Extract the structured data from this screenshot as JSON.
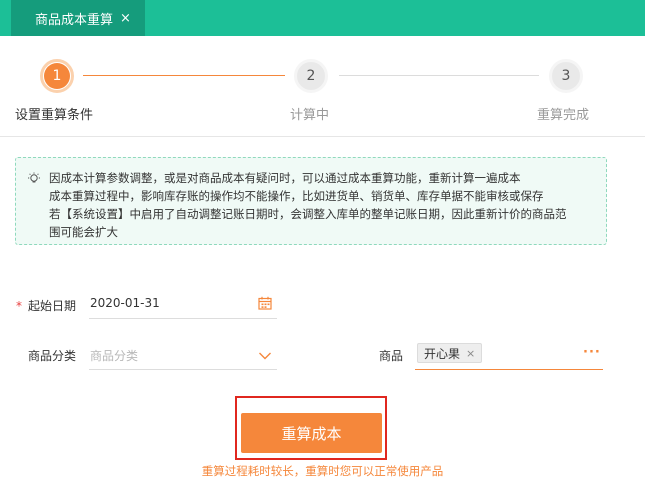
{
  "tab": {
    "label": "商品成本重算",
    "close": "×"
  },
  "steps": [
    {
      "number": "1",
      "label": "设置重算条件"
    },
    {
      "number": "2",
      "label": "计算中"
    },
    {
      "number": "3",
      "label": "重算完成"
    }
  ],
  "notice": {
    "lines": [
      "因成本计算参数调整，或是对商品成本有疑问时，可以通过成本重算功能，重新计算一遍成本",
      "成本重算过程中，影响库存账的操作均不能操作，比如进货单、销货单、库存单据不能审核或保存",
      "若【系统设置】中启用了自动调整记账日期时，会调整入库单的整单记账日期，因此重新计价的商品范",
      "围可能会扩大"
    ]
  },
  "form": {
    "start_date": {
      "required_mark": "*",
      "label": "起始日期",
      "value": "2020-01-31"
    },
    "category": {
      "label": "商品分类",
      "placeholder": "商品分类"
    },
    "product": {
      "label": "商品",
      "tag": "开心果",
      "tag_remove": "×",
      "more": "···"
    }
  },
  "actions": {
    "recalc_label": "重算成本",
    "hint": "重算过程耗时较长，重算时您可以正常使用产品"
  },
  "colors": {
    "topbar": "#1cbf97",
    "accent": "#f5873b"
  }
}
